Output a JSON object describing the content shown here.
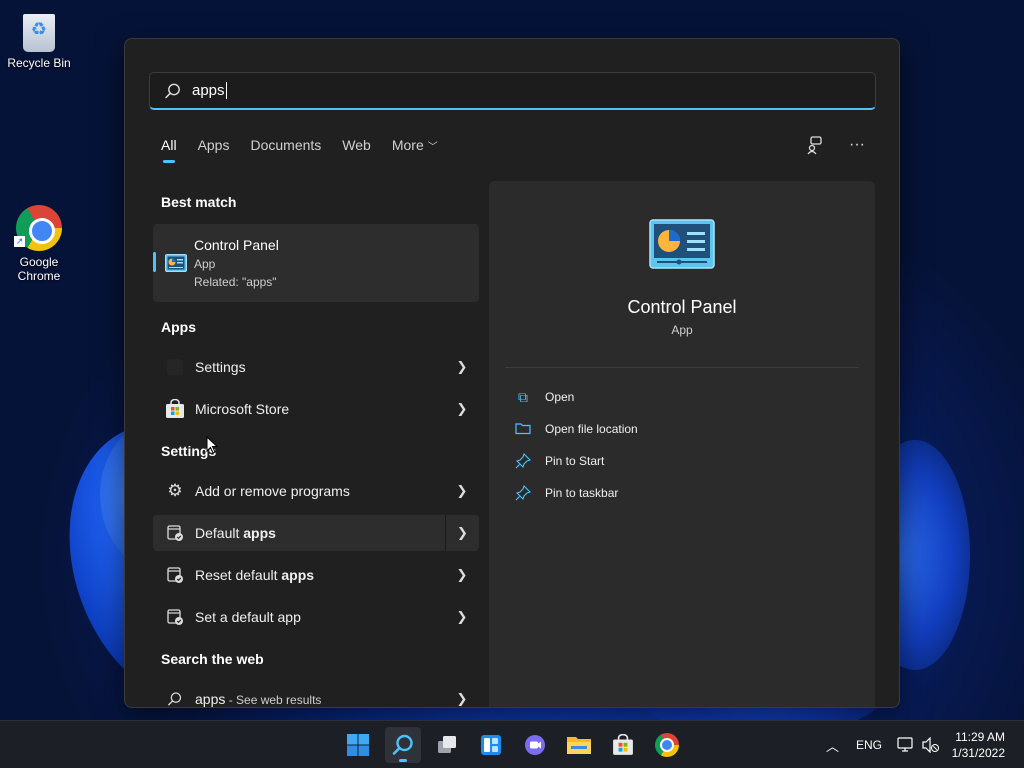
{
  "desktop": {
    "icons": [
      {
        "label": "Recycle Bin",
        "icon": "recycle-bin-icon"
      },
      {
        "label": "Google Chrome",
        "icon": "chrome-icon"
      }
    ]
  },
  "search": {
    "query": "apps",
    "tabs": [
      "All",
      "Apps",
      "Documents",
      "Web",
      "More"
    ],
    "active_tab": "All"
  },
  "results": {
    "best_match_heading": "Best match",
    "best_match": {
      "title": "Control Panel",
      "type": "App",
      "related": "Related: \"apps\""
    },
    "apps_heading": "Apps",
    "apps": [
      {
        "label": "Settings"
      },
      {
        "label": "Microsoft Store"
      }
    ],
    "settings_heading": "Settings",
    "settings": [
      {
        "label": "Add or remove programs"
      },
      {
        "label_pre": "Default ",
        "label_bold": "apps"
      },
      {
        "label_pre": "Reset default ",
        "label_bold": "apps"
      },
      {
        "label": "Set a default app"
      }
    ],
    "web_heading": "Search the web",
    "web": {
      "query": "apps",
      "suffix": " - See web results"
    }
  },
  "preview": {
    "title": "Control Panel",
    "type": "App",
    "actions": [
      "Open",
      "Open file location",
      "Pin to Start",
      "Pin to taskbar"
    ]
  },
  "taskbar": {
    "apps": [
      "start-icon",
      "search-icon",
      "task-view-icon",
      "widgets-icon",
      "chat-icon",
      "file-explorer-icon",
      "microsoft-store-icon",
      "chrome-icon"
    ],
    "language": "ENG",
    "time": "11:29 AM",
    "date": "1/31/2022"
  },
  "colors": {
    "accent": "#4cc2ff",
    "panel": "#202020",
    "preview": "#2b2b2b"
  }
}
